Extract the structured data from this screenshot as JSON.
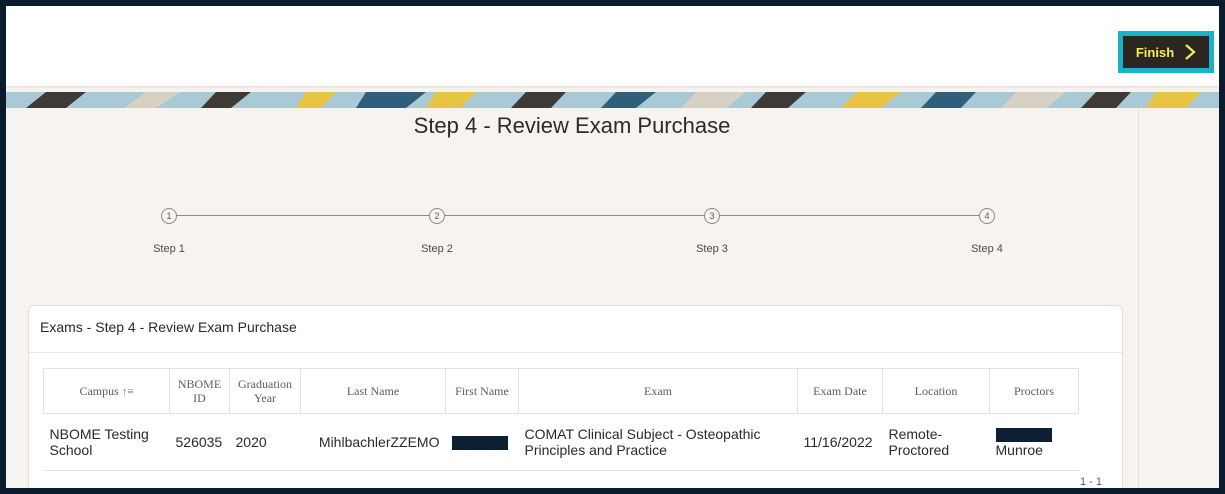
{
  "header": {
    "finish_label": "Finish"
  },
  "page": {
    "title": "Step 4 - Review Exam Purchase"
  },
  "wizard": {
    "steps": [
      {
        "number": "1",
        "label": "Step 1"
      },
      {
        "number": "2",
        "label": "Step 2"
      },
      {
        "number": "3",
        "label": "Step 3"
      },
      {
        "number": "4",
        "label": "Step 4"
      }
    ]
  },
  "report": {
    "title": "Exams - Step 4 - Review Exam Purchase",
    "columns": {
      "campus": "Campus",
      "nbome_id": "NBOME ID",
      "grad_year": "Graduation Year",
      "last_name": "Last Name",
      "first_name": "First Name",
      "exam": "Exam",
      "exam_date": "Exam Date",
      "location": "Location",
      "proctors": "Proctors"
    },
    "rows": [
      {
        "campus": "NBOME Testing School",
        "nbome_id": "526035",
        "grad_year": "2020",
        "last_name": "MihlbachlerZZEMO",
        "exam": "COMAT Clinical Subject - Osteopathic Principles and Practice",
        "exam_date": "11/16/2022",
        "location": "Remote-Proctored",
        "proctor_last": "Munroe"
      }
    ],
    "pagination": "1 - 1"
  },
  "colors": {
    "finish_text": "#f6ec5c",
    "finish_bg": "#2b2620",
    "highlight": "#18b3c8"
  }
}
